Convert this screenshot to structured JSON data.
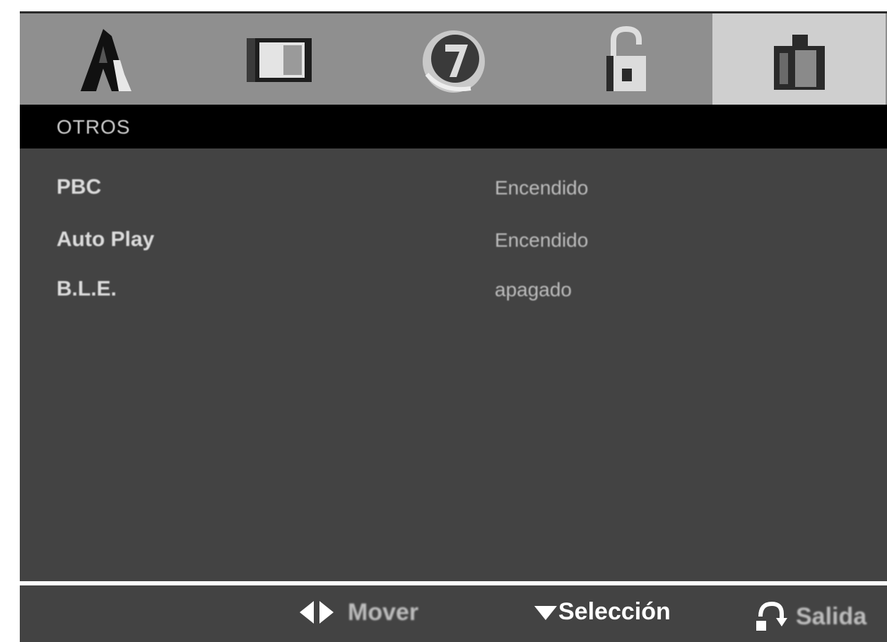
{
  "tabs": [
    {
      "icon": "language-icon",
      "active": false
    },
    {
      "icon": "display-icon",
      "active": false
    },
    {
      "icon": "audio-icon",
      "active": false
    },
    {
      "icon": "lock-icon",
      "active": false
    },
    {
      "icon": "others-icon",
      "active": true
    }
  ],
  "menu": {
    "heading": "OTROS",
    "items": [
      {
        "label": "PBC",
        "value": "Encendido"
      },
      {
        "label": "Auto Play",
        "value": "Encendido"
      },
      {
        "label": "B.L.E.",
        "value": "apagado"
      }
    ]
  },
  "footer": {
    "move_label": "Mover",
    "select_label": "Selección",
    "exit_label": "Salida"
  },
  "colors": {
    "tabbar": "#8f8f8f",
    "active_tab": "#cfcfcf",
    "panel": "#434343",
    "heading_bar": "#000000"
  }
}
